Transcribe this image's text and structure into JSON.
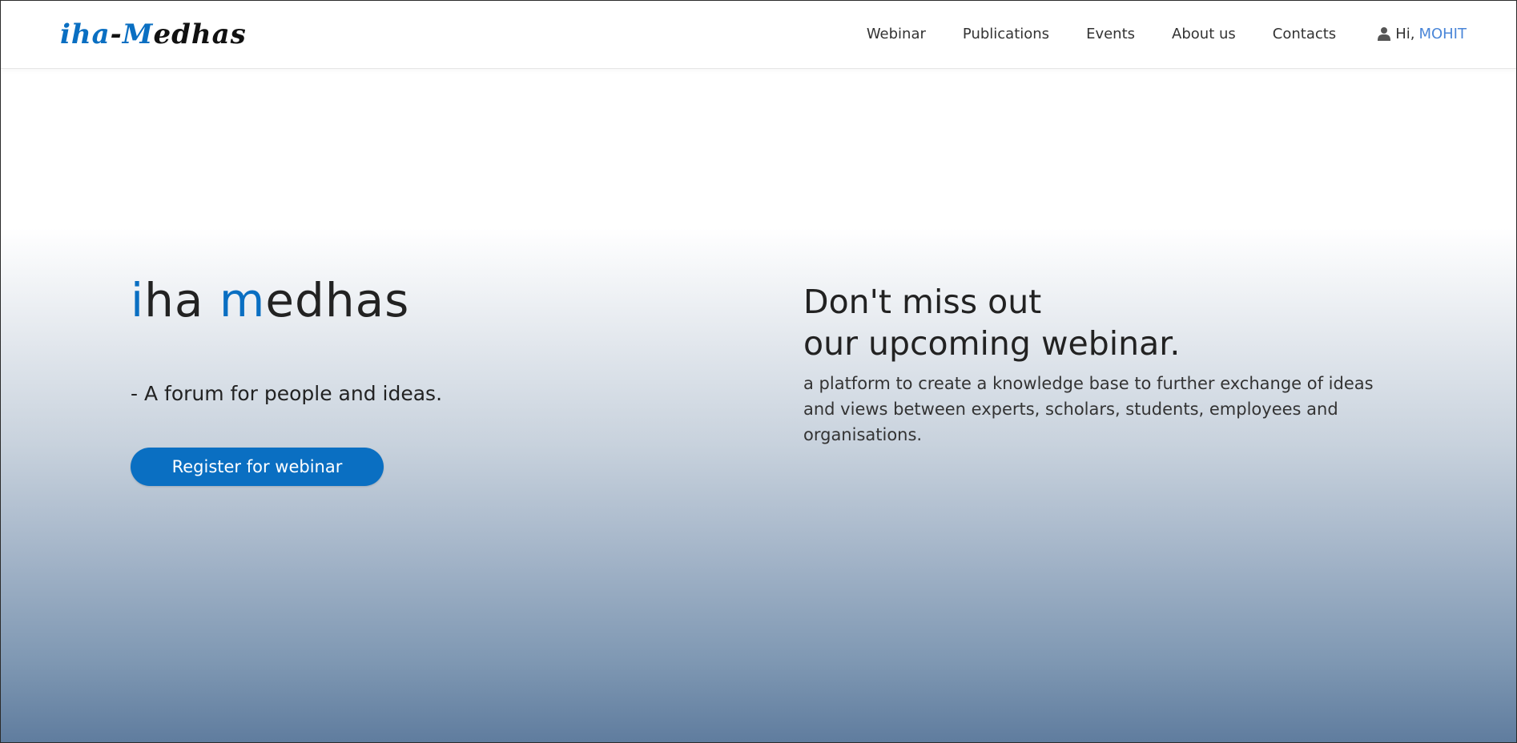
{
  "header": {
    "logo": {
      "part1": "iha",
      "part2": "-",
      "part3": "M",
      "part4": "edhas"
    },
    "nav": [
      {
        "label": "Webinar"
      },
      {
        "label": "Publications"
      },
      {
        "label": "Events"
      },
      {
        "label": "About us"
      },
      {
        "label": "Contacts"
      }
    ],
    "user": {
      "icon": "user-icon",
      "greeting": "Hi,",
      "name": "MOHIT"
    }
  },
  "hero": {
    "brand": {
      "part1": "i",
      "part2": "ha ",
      "part3": "m",
      "part4": "edhas"
    },
    "tagline": "- A forum for people and ideas.",
    "cta_label": "Register for webinar",
    "promo_heading_line1": "Don't miss out",
    "promo_heading_line2": "our upcoming webinar.",
    "promo_text": "a platform to create a knowledge base to further exchange of ideas and views between experts, scholars, students, employees and organisations."
  },
  "colors": {
    "accent": "#0a6fc2",
    "user_name": "#4a86d8",
    "gradient_bottom": "#5f7c9e"
  }
}
